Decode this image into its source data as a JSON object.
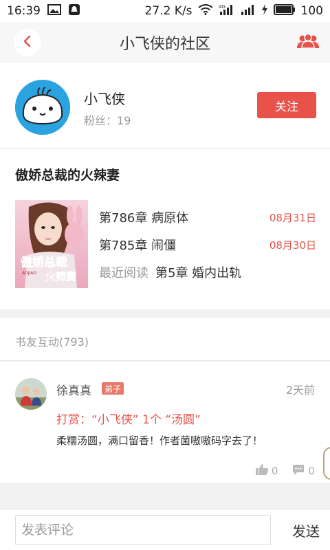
{
  "status_bar": {
    "time": "16:39",
    "speed": "27.2 K/s",
    "network": "4G",
    "battery": "100"
  },
  "header": {
    "title": "小飞侠的社区"
  },
  "profile": {
    "name": "小飞侠",
    "fans": "粉丝：19",
    "follow_label": "关注"
  },
  "book": {
    "title": "傲娇总裁的火辣妻",
    "chapters": [
      {
        "name": "第786章 病原体",
        "date": "08月31日"
      },
      {
        "name": "第785章 闹僵",
        "date": "08月30日"
      }
    ],
    "recent_label": "最近阅读",
    "recent_chapter": "第5章 婚内出轨",
    "cover_text": "傲娇总裁",
    "cover_text2": "火辣妻",
    "cover_sub": "AOJIAO"
  },
  "interaction": {
    "label": "书友互动(793)"
  },
  "comment": {
    "user": "徐真真",
    "badge": "弟子",
    "time": "2天前",
    "reward": "打赏：“小飞侠”  1个 “汤圆”",
    "text": "柔糯汤圆，满口留香！作者菌嗷嗷码字去了！",
    "likes": "0",
    "replies": "0"
  },
  "input_bar": {
    "placeholder": "发表评论",
    "send_label": "发送"
  },
  "colors": {
    "accent": "#e8524a",
    "avatar_bg": "#2ba3e0"
  }
}
